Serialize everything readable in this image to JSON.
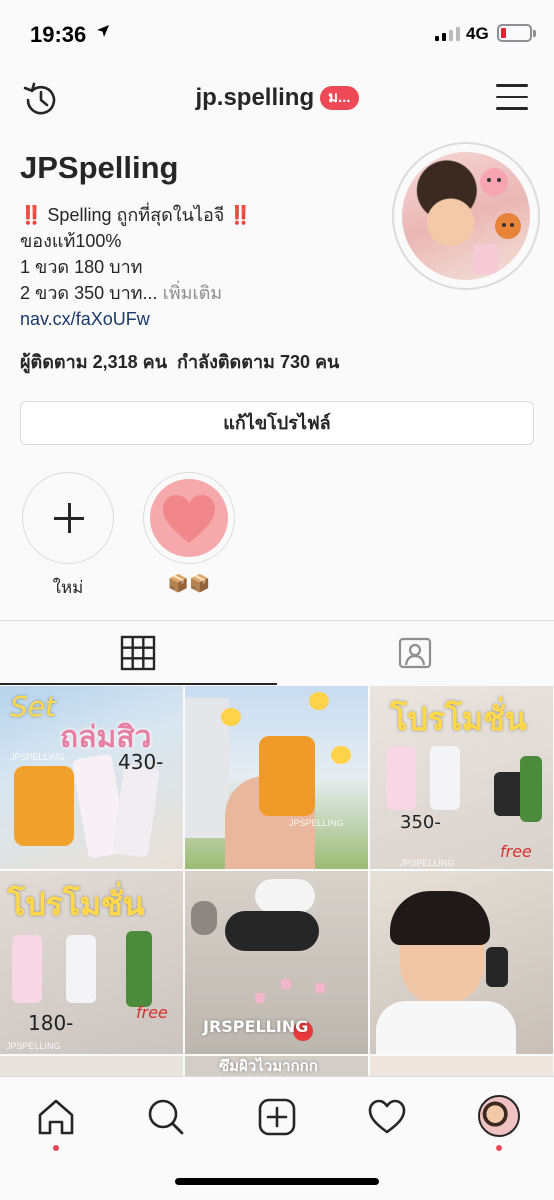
{
  "status_bar": {
    "time": "19:36",
    "network": "4G",
    "battery_color": "#e0262d"
  },
  "header": {
    "username": "jp.spelling",
    "badge": "ม...",
    "left_icon": "history-icon",
    "right_icon": "menu-icon"
  },
  "profile": {
    "display_name": "JPSpelling",
    "bio_line1_emoji_left": "‼️",
    "bio_line1_text": " Spelling ถูกที่สุดในไอจี ",
    "bio_line1_emoji_right": "‼️",
    "bio_line2": "ของแท้100%",
    "bio_line3": "1 ขวด 180 บาท",
    "bio_line4": "2 ขวด 350 บาท...",
    "bio_more": " เพิ่มเติม",
    "link": "nav.cx/faXoUFw",
    "followers_label": "ผู้ติดตาม",
    "followers_count": "2,318",
    "followers_unit": "คน",
    "following_label": "กำลังติดตาม",
    "following_count": "730",
    "following_unit": "คน",
    "edit_button": "แก้ไขโปรไฟล์"
  },
  "highlights": [
    {
      "label": "ใหม่",
      "icon": "plus-icon"
    },
    {
      "label": "📦📦",
      "icon": "heart-icon"
    }
  ],
  "tabs": [
    {
      "name": "grid",
      "icon": "grid-icon",
      "active": true
    },
    {
      "name": "tagged",
      "icon": "tagged-person-icon",
      "active": false
    }
  ],
  "posts": {
    "p1": {
      "t1": "Set",
      "t2": "ถล่มสิว",
      "t3": "430-",
      "wm": "JPSPELLING"
    },
    "p2": {
      "wm": "JPSPELLING"
    },
    "p3": {
      "t1": "โปรโมชั่น",
      "t2": "350-",
      "t3": "free",
      "wm": "JPSPELLING"
    },
    "p4": {
      "t1": "โปรโมชั่น",
      "t2": "180-",
      "t3": "free",
      "wm": "JPSPELLING"
    },
    "p5": {
      "t1": "JRSPELLING"
    },
    "p8": {
      "t1": "ซึมผิวไวมากกก"
    }
  },
  "bottom_nav": [
    {
      "name": "home",
      "icon": "home-icon"
    },
    {
      "name": "search",
      "icon": "search-icon"
    },
    {
      "name": "new-post",
      "icon": "add-post-icon"
    },
    {
      "name": "activity",
      "icon": "heart-outline-icon"
    },
    {
      "name": "profile",
      "icon": "profile-avatar-icon"
    }
  ]
}
